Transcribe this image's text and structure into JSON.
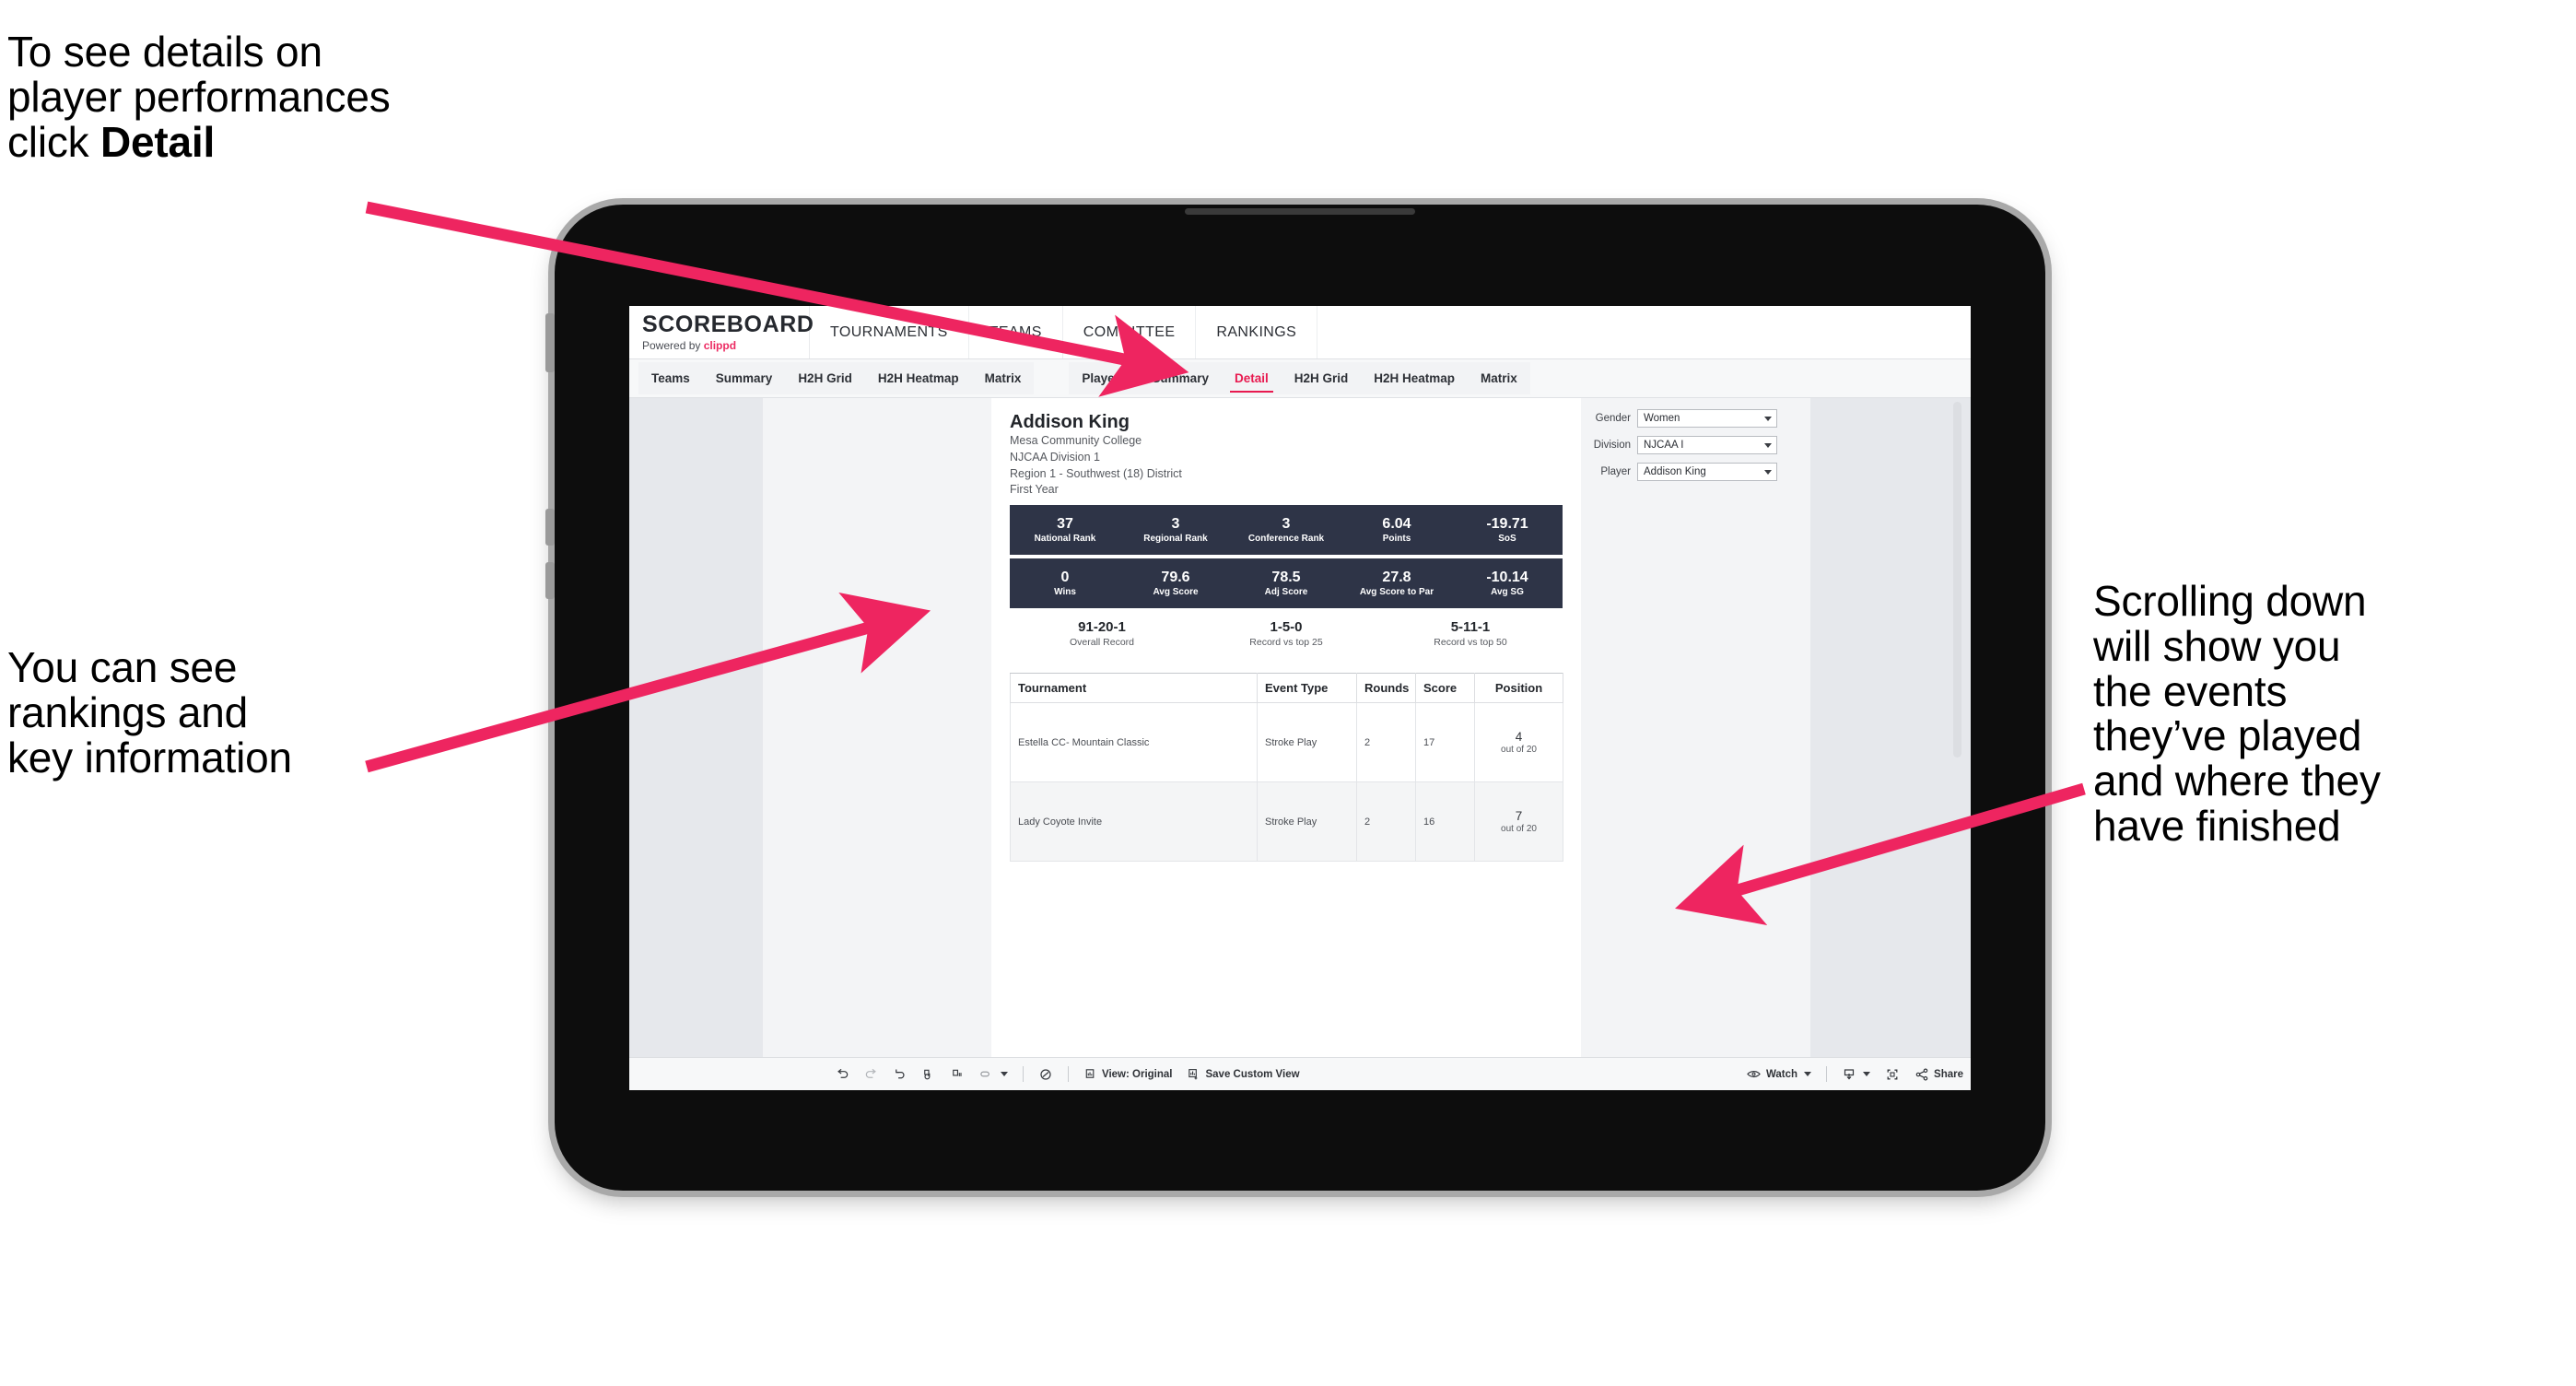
{
  "annotations": {
    "top_left": {
      "line1": "To see details on",
      "line2": "player performances",
      "line3_prefix": "click ",
      "line3_bold": "Detail"
    },
    "mid_left": {
      "line1": "You can see",
      "line2": "rankings and",
      "line3": "key information"
    },
    "right": {
      "line1": "Scrolling down",
      "line2": "will show you",
      "line3": "the events",
      "line4": "they’ve played",
      "line5": "and where they",
      "line6": "have finished"
    },
    "arrow_color": "#ee2560"
  },
  "app": {
    "brand": {
      "title": "SCOREBOARD",
      "powered_prefix": "Powered by ",
      "powered_name": "clippd",
      "accent": "#ec2b62"
    },
    "top_nav": [
      {
        "label": "TOURNAMENTS"
      },
      {
        "label": "TEAMS"
      },
      {
        "label": "COMMITTEE"
      },
      {
        "label": "RANKINGS"
      }
    ],
    "tabs_group_1": [
      {
        "label": "Teams",
        "active": false
      },
      {
        "label": "Summary",
        "active": false
      },
      {
        "label": "H2H Grid",
        "active": false
      },
      {
        "label": "H2H Heatmap",
        "active": false
      },
      {
        "label": "Matrix",
        "active": false
      }
    ],
    "tabs_group_2": [
      {
        "label": "Players",
        "active": false
      },
      {
        "label": "Summary",
        "active": false
      },
      {
        "label": "Detail",
        "active": true
      },
      {
        "label": "H2H Grid",
        "active": false
      },
      {
        "label": "H2H Heatmap",
        "active": false
      },
      {
        "label": "Matrix",
        "active": false
      }
    ],
    "active_tab_color": "#e8194f"
  },
  "player": {
    "name": "Addison King",
    "school": "Mesa Community College",
    "division": "NJCAA Division 1",
    "region": "Region 1 - Southwest (18) District",
    "class_year": "First Year"
  },
  "selectors": [
    {
      "label": "Gender",
      "value": "Women"
    },
    {
      "label": "Division",
      "value": "NJCAA I"
    },
    {
      "label": "Player",
      "value": "Addison King"
    }
  ],
  "kpi_band_1": [
    {
      "value": "37",
      "label": "National Rank"
    },
    {
      "value": "3",
      "label": "Regional Rank"
    },
    {
      "value": "3",
      "label": "Conference Rank"
    },
    {
      "value": "6.04",
      "label": "Points"
    },
    {
      "value": "-19.71",
      "label": "SoS"
    }
  ],
  "kpi_band_2": [
    {
      "value": "0",
      "label": "Wins"
    },
    {
      "value": "79.6",
      "label": "Avg Score"
    },
    {
      "value": "78.5",
      "label": "Adj Score"
    },
    {
      "value": "27.8",
      "label": "Avg Score to Par"
    },
    {
      "value": "-10.14",
      "label": "Avg SG"
    }
  ],
  "records": [
    {
      "value": "91-20-1",
      "label": "Overall Record"
    },
    {
      "value": "1-5-0",
      "label": "Record vs top 25"
    },
    {
      "value": "5-11-1",
      "label": "Record vs top 50"
    }
  ],
  "events_table": {
    "columns": [
      "Tournament",
      "Event Type",
      "Rounds",
      "Score",
      "Position"
    ],
    "rows": [
      {
        "tournament": "Estella CC- Mountain Classic",
        "event_type": "Stroke Play",
        "rounds": "2",
        "score": "17",
        "position_num": "4",
        "position_sub": "out of 20"
      },
      {
        "tournament": "Lady Coyote Invite",
        "event_type": "Stroke Play",
        "rounds": "2",
        "score": "16",
        "position_num": "7",
        "position_sub": "out of 20"
      }
    ]
  },
  "toolbar": {
    "view_label": "View: Original",
    "save_label": "Save Custom View",
    "watch_label": "Watch",
    "share_label": "Share"
  },
  "kpi_band_color": "#2e3447"
}
